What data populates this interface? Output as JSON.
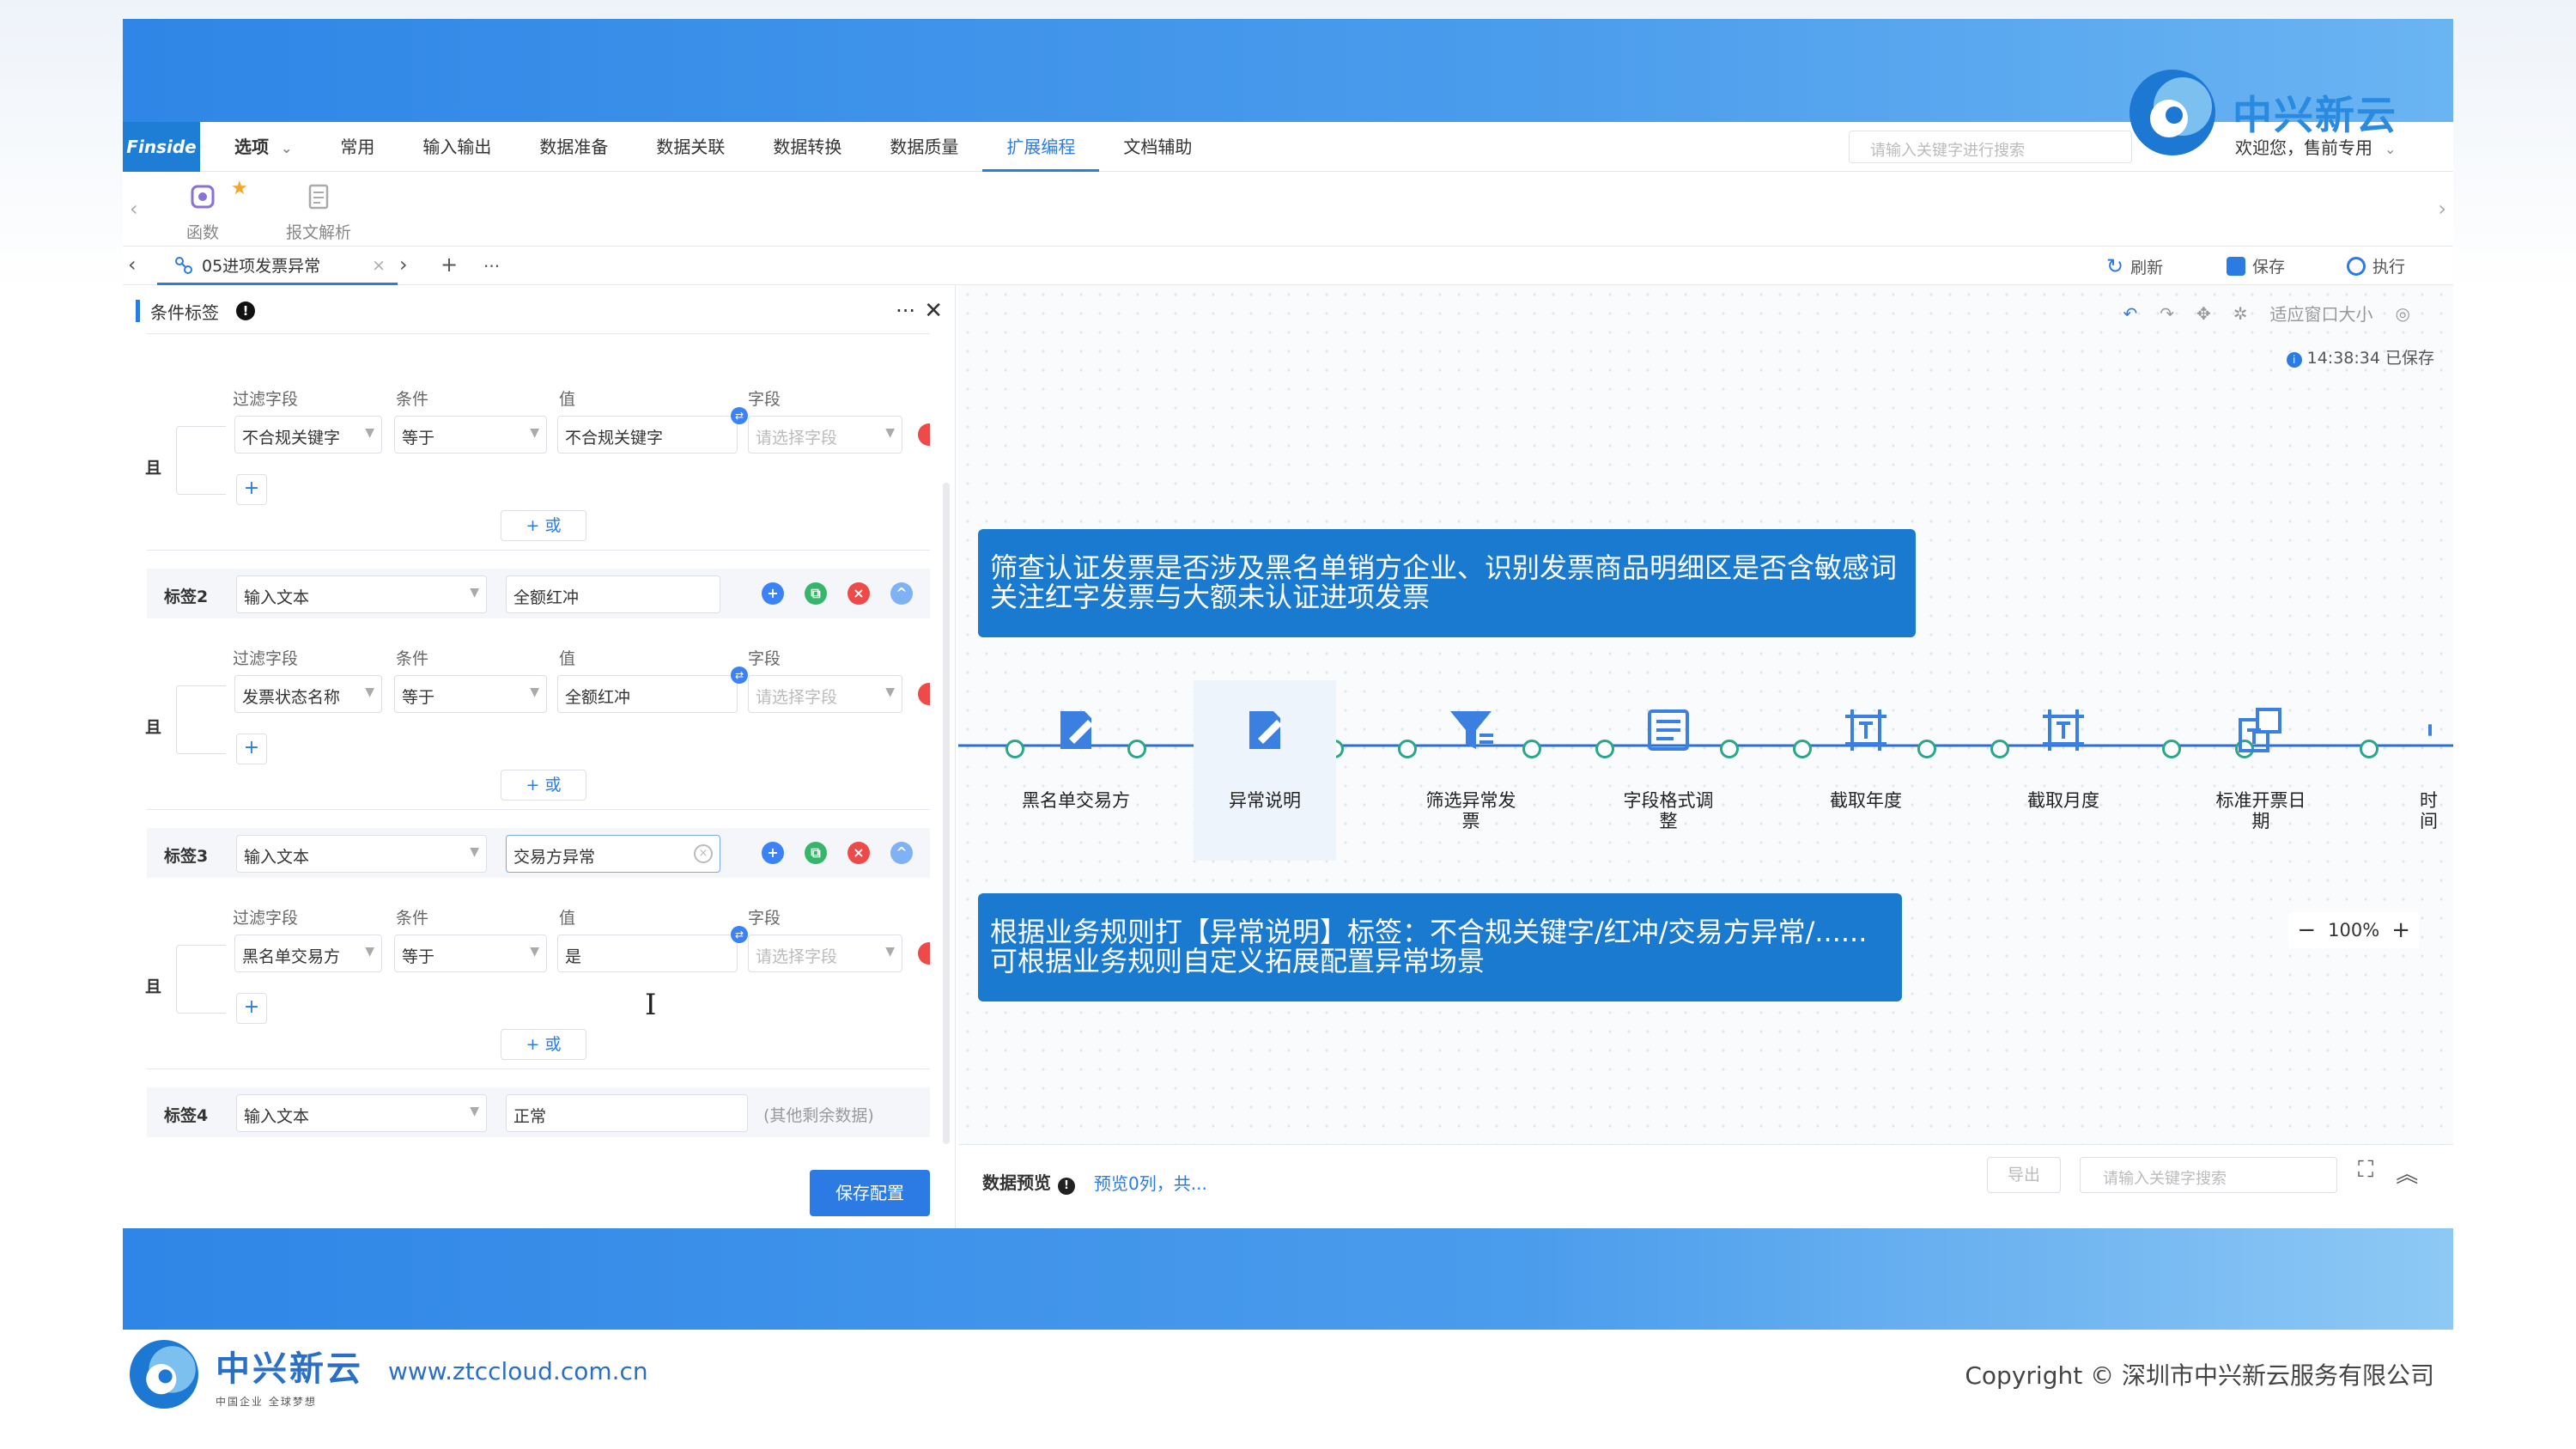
{
  "brand": {
    "name": "中兴新云",
    "footer_sub": "中国企业 全球梦想",
    "url": "www.ztccloud.com.cn",
    "copyright": "Copyright © 深圳市中兴新云服务有限公司",
    "color": "#2a8ae0"
  },
  "menubar": {
    "logo": "Finside",
    "items": [
      "选项",
      "常用",
      "输入输出",
      "数据准备",
      "数据关联",
      "数据转换",
      "数据质量",
      "扩展编程",
      "文档辅助"
    ],
    "active": "扩展编程",
    "search_placeholder": "请输入关键字进行搜索",
    "welcome": "欢迎您，售前专用"
  },
  "ribbon": {
    "buttons": [
      {
        "label": "函数",
        "icon": "function-icon"
      },
      {
        "label": "报文解析",
        "icon": "message-parse-icon"
      }
    ]
  },
  "tabbar": {
    "tab_label": "05进项发票异常",
    "close": "×",
    "add": "+",
    "more": "···",
    "refresh": "刷新",
    "save": "保存",
    "run": "执行"
  },
  "panel": {
    "title": "条件标签",
    "hdr_filter": "过滤字段",
    "hdr_cond": "条件",
    "hdr_value": "值",
    "hdr_field": "字段",
    "and": "且",
    "or": "+ 或",
    "field_placeholder": "请选择字段",
    "group1": {
      "filter": "不合规关键字",
      "cond": "等于",
      "value": "不合规关键字"
    },
    "tag2": {
      "name": "标签2",
      "type": "输入文本",
      "text": "全额红冲"
    },
    "group2": {
      "filter": "发票状态名称",
      "cond": "等于",
      "value": "全额红冲"
    },
    "tag3": {
      "name": "标签3",
      "type": "输入文本",
      "text": "交易方异常"
    },
    "group3": {
      "filter": "黑名单交易方",
      "cond": "等于",
      "value": "是"
    },
    "tag4": {
      "name": "标签4",
      "type": "输入文本",
      "text": "正常",
      "note": "(其他剩余数据)"
    },
    "save": "保存配置"
  },
  "canvas": {
    "fit": "适应窗口大小",
    "saved": "14:38:34 已保存",
    "callout1": [
      "筛查认证发票是否涉及黑名单销方企业、识别发票商品明细区是否含敏感词",
      "关注红字发票与大额未认证进项发票"
    ],
    "callout2": [
      "根据业务规则打【异常说明】标签：不合规关键字/红冲/交易方异常/......",
      "可根据业务规则自定义拓展配置异常场景"
    ],
    "nodes": [
      {
        "label": "黑名单交易方",
        "icon": "tag-edit-icon"
      },
      {
        "label": "异常说明",
        "icon": "tag-edit-icon"
      },
      {
        "label": "筛选异常发票",
        "icon": "filter-icon"
      },
      {
        "label": "字段格式调整",
        "icon": "format-icon"
      },
      {
        "label": "截取年度",
        "icon": "substring-icon"
      },
      {
        "label": "截取月度",
        "icon": "substring-icon"
      },
      {
        "label": "标准开票日期",
        "icon": "date-standard-icon"
      },
      {
        "label": "时间",
        "icon": "time-icon"
      }
    ],
    "zoom": "100%"
  },
  "preview": {
    "title": "数据预览",
    "info": "预览0列，共...",
    "export": "导出",
    "search_placeholder": "请输入关键字搜索"
  }
}
